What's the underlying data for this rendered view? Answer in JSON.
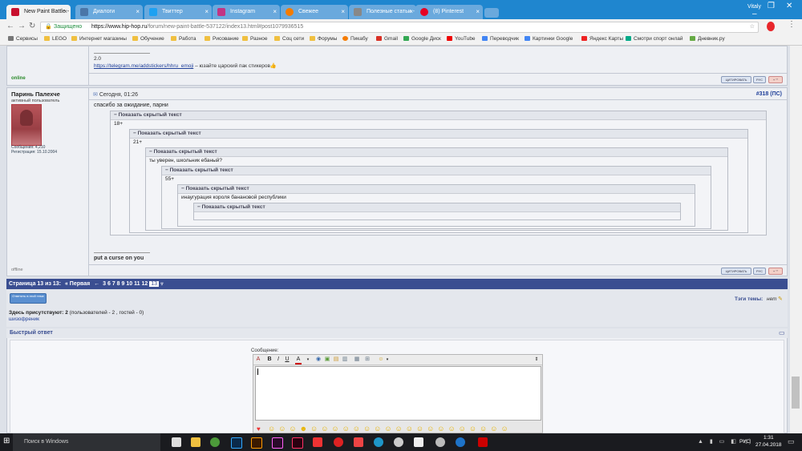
{
  "browser": {
    "tabs": [
      {
        "label": "New Paint Battle -",
        "favicon_color": "#c8102e",
        "active": true
      },
      {
        "label": "Диалоги",
        "favicon_color": "#4a76a8"
      },
      {
        "label": "Твиттер",
        "favicon_color": "#1da1f2"
      },
      {
        "label": "Instagram",
        "favicon_color": "#c13584"
      },
      {
        "label": "Свежее",
        "favicon_color": "#f57c00"
      },
      {
        "label": "Полезные статьи -",
        "favicon_color": "#888888"
      },
      {
        "label": "(8) Pinterest",
        "favicon_color": "#e60023"
      }
    ],
    "user": "Vitaly",
    "secure_label": "Защищено",
    "url_host": "https://www.hip-hop.ru",
    "url_path": "/forum/new-paint-battle-537122/index13.html#post1079936515",
    "bookmarks": [
      {
        "label": "Сервисы",
        "icon": "apps-icon"
      },
      {
        "label": "LEGO",
        "icon": "folder-icon"
      },
      {
        "label": "Интернет магазины",
        "icon": "folder-icon"
      },
      {
        "label": "Обучение",
        "icon": "folder-icon"
      },
      {
        "label": "Работа",
        "icon": "folder-icon"
      },
      {
        "label": "Рисование",
        "icon": "folder-icon"
      },
      {
        "label": "Разное",
        "icon": "folder-icon"
      },
      {
        "label": "Соц сети",
        "icon": "folder-icon"
      },
      {
        "label": "Форумы",
        "icon": "folder-icon"
      },
      {
        "label": "Пикабу",
        "icon": "pikabu-icon"
      },
      {
        "label": "Gmail",
        "icon": "gmail-icon"
      },
      {
        "label": "Google Диск",
        "icon": "drive-icon"
      },
      {
        "label": "YouTube",
        "icon": "youtube-icon"
      },
      {
        "label": "Переводчик",
        "icon": "translate-icon"
      },
      {
        "label": "Картинки Google",
        "icon": "google-icon"
      },
      {
        "label": "Яндекс Карты",
        "icon": "yandex-icon"
      },
      {
        "label": "Смотри спорт онлай",
        "icon": "sport-icon"
      },
      {
        "label": "Дневник.ру",
        "icon": "diary-icon"
      }
    ]
  },
  "prev_post": {
    "version": "2.0",
    "link": "https://telegram.me/addstickers/hhru_emoji",
    "link_tail": " – юзайте царский пак стикеров",
    "status": "online"
  },
  "post": {
    "author": "Паринь Палехче",
    "rank": "активный пользователь",
    "messages": "Сообщения: 4,210",
    "registered": "Регистрация: 15.10.2004",
    "date": "Сегодня, 01:26",
    "number": "#318 (ПС)",
    "text": "спасибо за ожидание, парни",
    "spoiler_label": "− Показать скрытый текст",
    "spoilers": [
      "18+",
      "21+",
      "ты уверен, школьник ебаный?",
      "55+",
      "инаугурация короля банановой республики",
      ""
    ],
    "signature": "put a curse on you",
    "status": "offline"
  },
  "buttons": {
    "quote": "ЦИТИРОВАТЬ",
    "rus": "РУС",
    "multi": "+ \"\""
  },
  "pagination": {
    "label": "Страница 13 из 13:",
    "first": "« Первая",
    "prev": "←",
    "pages": [
      "3",
      "6",
      "7",
      "8",
      "9",
      "10",
      "11",
      "12"
    ],
    "current": "13"
  },
  "info": {
    "reply_button": "Ответить в этой теме",
    "tags_label": "Тэги темы:",
    "tags_value": "нет",
    "present_label": "Здесь присутствуют: 2",
    "present_detail": " (пользователей - 2 , гостей - 0)",
    "present_user": "шизофреник"
  },
  "quick_reply": {
    "title": "Быстрый ответ",
    "message_label": "Сообщение:"
  },
  "taskbar": {
    "search": "Поиск в Windows",
    "lang": "РУС",
    "time": "1:31",
    "date": "27.04.2018"
  },
  "colors": {
    "chrome_blue": "#1f86cf",
    "forum_blue": "#3a4e91",
    "link": "#1f3f99"
  }
}
